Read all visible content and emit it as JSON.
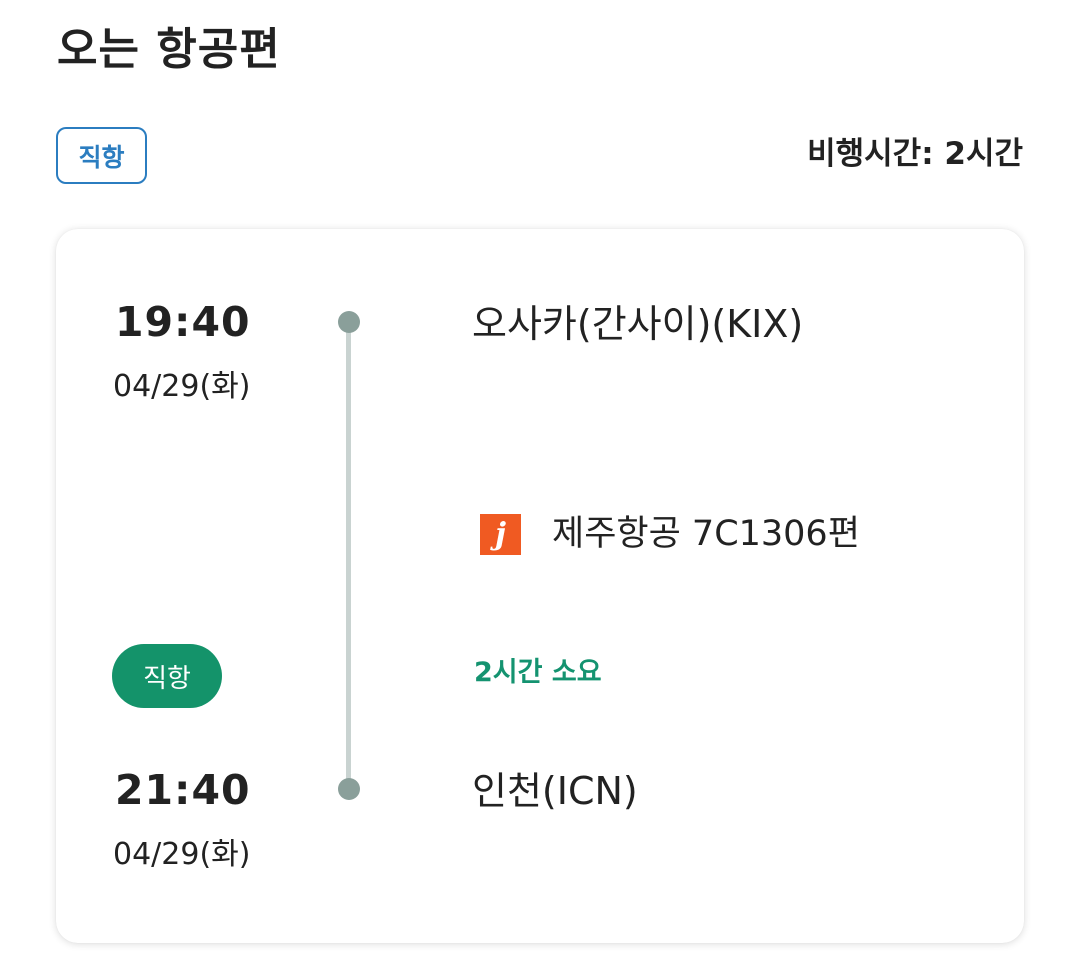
{
  "header": {
    "title": "오는 항공편",
    "direct_chip": "직항",
    "flight_duration": "비행시간: 2시간"
  },
  "flight": {
    "departure": {
      "time": "19:40",
      "date": "04/29(화)",
      "airport": "오사카(간사이)(KIX)"
    },
    "airline": {
      "logo_letter": "j",
      "logo_color": "#f05a22",
      "name": "제주항공 7C1306편"
    },
    "stop_type": "직항",
    "elapsed": "2시간 소요",
    "arrival": {
      "time": "21:40",
      "date": "04/29(화)",
      "airport": "인천(ICN)"
    }
  },
  "colors": {
    "chip_blue": "#2b7dc0",
    "direct_green": "#14936a",
    "elapsed_green": "#149370",
    "timeline_line": "#c9d3d1",
    "timeline_dot": "#8a9f9a"
  }
}
